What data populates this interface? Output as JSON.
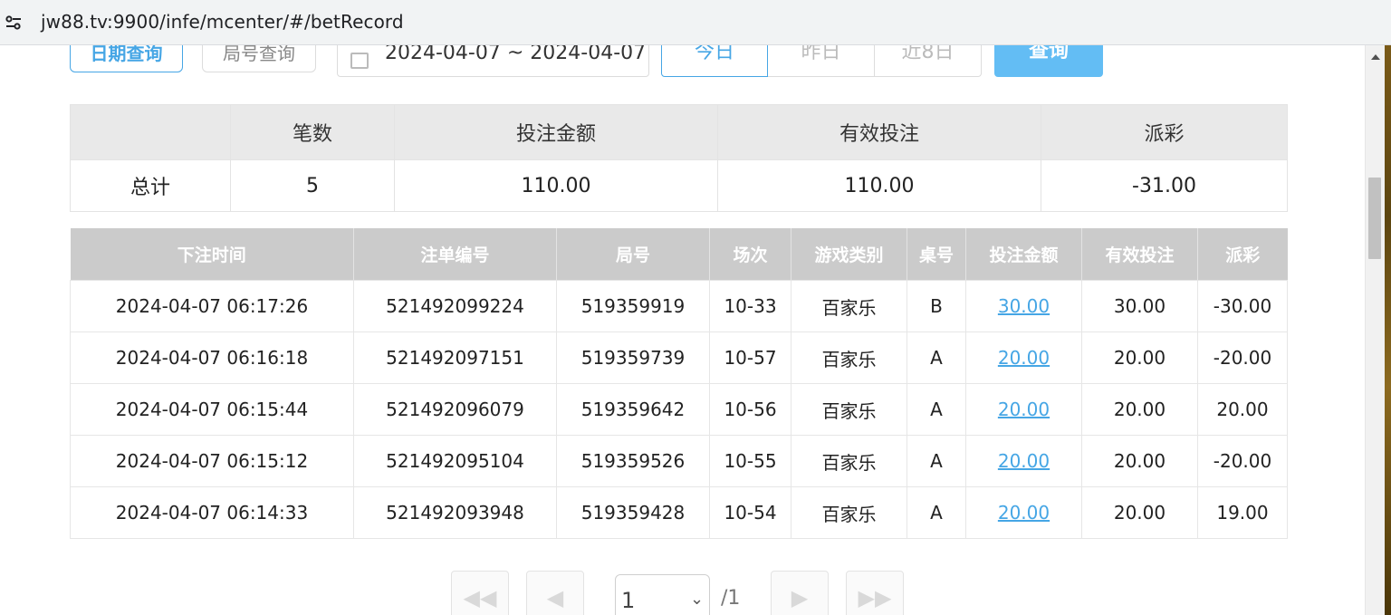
{
  "browser": {
    "url": "jw88.tv:9900/infe/mcenter/#/betRecord",
    "site_info_icon": "tune-icon"
  },
  "filters": {
    "date_query_label": "日期查询",
    "round_query_label": "局号查询",
    "date_range": "2024-04-07 ~ 2024-04-07",
    "today_label": "今日",
    "yesterday_label": "昨日",
    "last7_label": "近8日",
    "query_label": "查询"
  },
  "summary": {
    "headers": [
      "",
      "笔数",
      "投注金额",
      "有效投注",
      "派彩"
    ],
    "row_label": "总计",
    "count": "5",
    "bet_amount": "110.00",
    "valid_bet": "110.00",
    "payout": "-31.00"
  },
  "records": {
    "headers": [
      "下注时间",
      "注单编号",
      "局号",
      "场次",
      "游戏类别",
      "桌号",
      "投注金额",
      "有效投注",
      "派彩"
    ],
    "rows": [
      {
        "time": "2024-04-07 06:17:26",
        "bet_id": "521492099224",
        "round": "519359919",
        "session": "10-33",
        "game": "百家乐",
        "table": "B",
        "amount": "30.00",
        "valid": "30.00",
        "payout": "-30.00"
      },
      {
        "time": "2024-04-07 06:16:18",
        "bet_id": "521492097151",
        "round": "519359739",
        "session": "10-57",
        "game": "百家乐",
        "table": "A",
        "amount": "20.00",
        "valid": "20.00",
        "payout": "-20.00"
      },
      {
        "time": "2024-04-07 06:15:44",
        "bet_id": "521492096079",
        "round": "519359642",
        "session": "10-56",
        "game": "百家乐",
        "table": "A",
        "amount": "20.00",
        "valid": "20.00",
        "payout": "20.00"
      },
      {
        "time": "2024-04-07 06:15:12",
        "bet_id": "521492095104",
        "round": "519359526",
        "session": "10-55",
        "game": "百家乐",
        "table": "A",
        "amount": "20.00",
        "valid": "20.00",
        "payout": "-20.00"
      },
      {
        "time": "2024-04-07 06:14:33",
        "bet_id": "521492093948",
        "round": "519359428",
        "session": "10-54",
        "game": "百家乐",
        "table": "A",
        "amount": "20.00",
        "valid": "20.00",
        "payout": "19.00"
      }
    ]
  },
  "pagination": {
    "first_icon": "double-chevron-left-icon",
    "prev_icon": "chevron-left-icon",
    "next_icon": "chevron-right-icon",
    "last_icon": "double-chevron-right-icon",
    "current_page": "1",
    "total_pages": "/1"
  },
  "colors": {
    "accent": "#46a6e5",
    "negative": "#ee4455",
    "header_gray": "#cbcbcb"
  }
}
